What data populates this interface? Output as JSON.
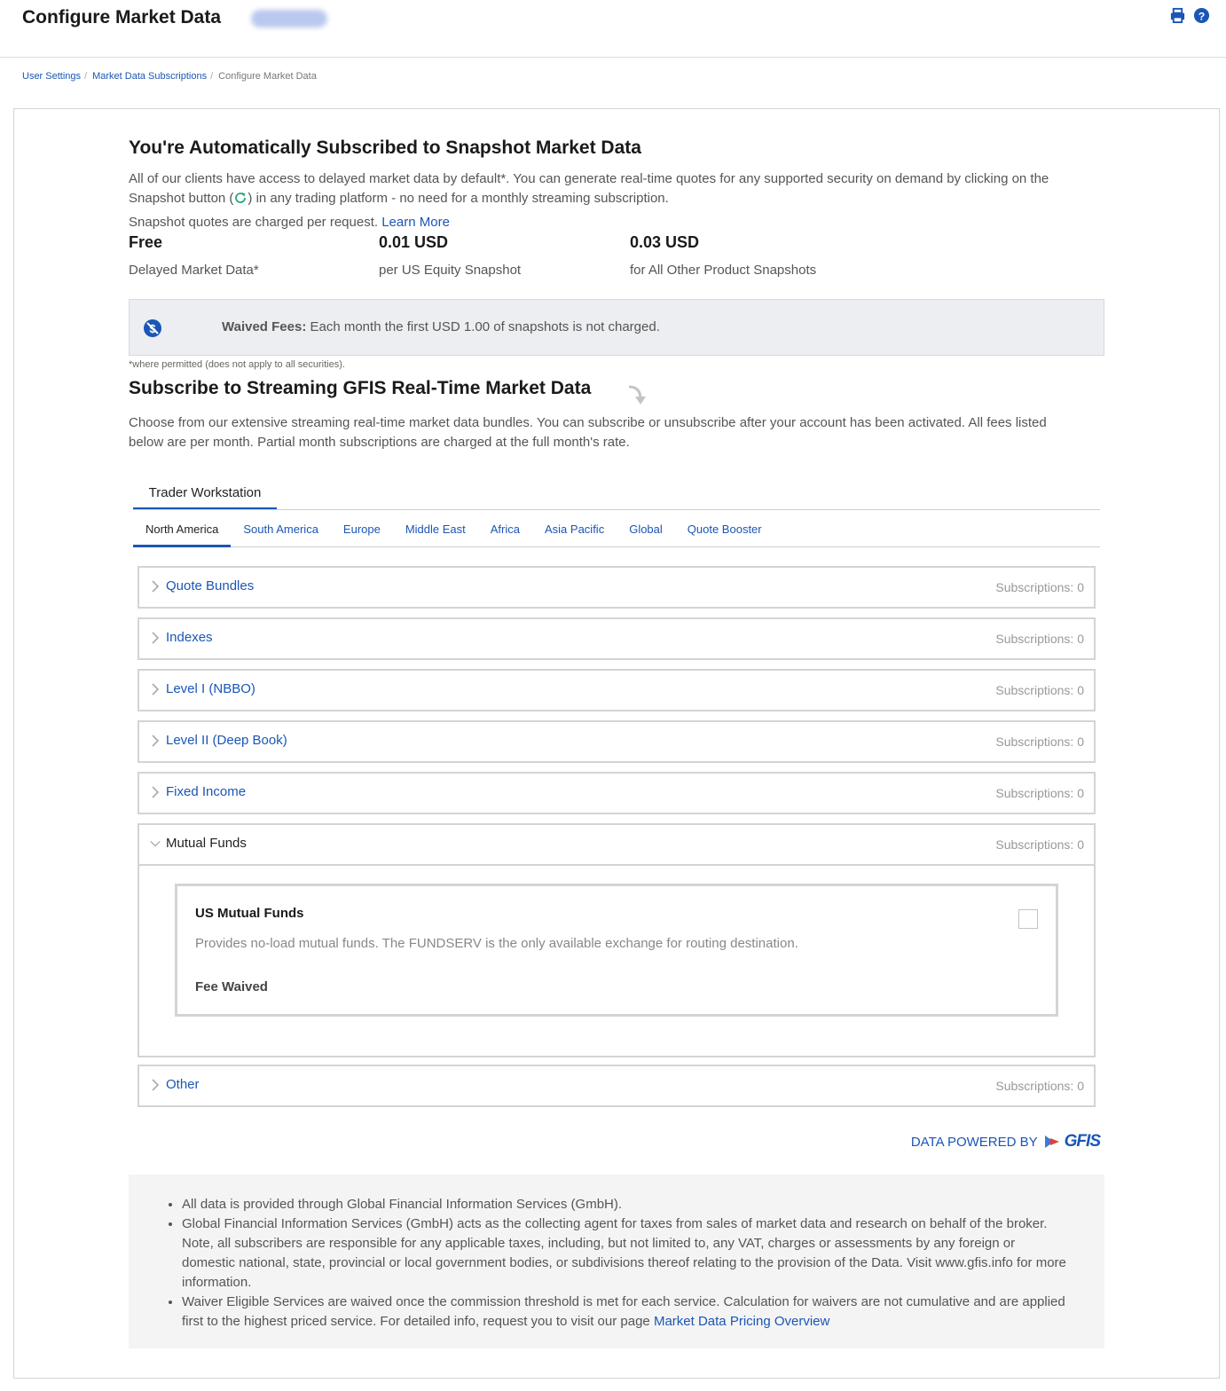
{
  "header": {
    "title": "Configure Market Data",
    "icons": [
      "print-icon",
      "help-icon"
    ]
  },
  "breadcrumb": [
    "User Settings",
    "Market Data Subscriptions",
    "Configure Market Data"
  ],
  "snapshot": {
    "heading": "You're Automatically Subscribed to Snapshot Market Data",
    "para1_a": "All of our clients have access to delayed market data by default*. You can generate real-time quotes for any supported security on demand by clicking on the",
    "para1_b": "Snapshot button (",
    "para1_c": ") in any trading platform - no need for a monthly streaming subscription.",
    "para2": "Snapshot quotes are charged per request.",
    "learn_more": "Learn More",
    "prices": [
      {
        "value": "Free",
        "label": "Delayed Market Data*"
      },
      {
        "value": "0.01 USD",
        "label": "per US Equity Snapshot"
      },
      {
        "value": "0.03 USD",
        "label": "for All Other Product Snapshots"
      }
    ],
    "waived_label": "Waived Fees:",
    "waived_text": "Each month the first USD 1.00 of snapshots is not charged.",
    "footnote": "*where permitted (does not apply to all securities)."
  },
  "streaming": {
    "heading": "Subscribe to Streaming GFIS Real-Time Market Data",
    "para_a": "Choose from our extensive streaming real-time market data bundles. You can subscribe or unsubscribe after your account has been activated. All fees listed",
    "para_b": "below are per month. Partial month subscriptions are charged at the full month's rate."
  },
  "platform_tab": "Trader Workstation",
  "region_tabs": [
    "North America",
    "South America",
    "Europe",
    "Middle East",
    "Africa",
    "Asia Pacific",
    "Global",
    "Quote Booster"
  ],
  "active_region": "North America",
  "categories": [
    {
      "title": "Quote Bundles",
      "count": "Subscriptions: 0"
    },
    {
      "title": "Indexes",
      "count": "Subscriptions: 0"
    },
    {
      "title": "Level I (NBBO)",
      "count": "Subscriptions: 0"
    },
    {
      "title": "Level II (Deep Book)",
      "count": "Subscriptions: 0"
    },
    {
      "title": "Fixed Income",
      "count": "Subscriptions: 0"
    },
    {
      "title": "Mutual Funds",
      "count": "Subscriptions: 0"
    },
    {
      "title": "Other",
      "count": "Subscriptions: 0"
    }
  ],
  "mutual_funds_card": {
    "title": "US Mutual Funds",
    "description": "Provides no-load mutual funds. The FUNDSERV is the only available exchange for routing destination.",
    "fee": "Fee Waived",
    "checked": false
  },
  "powered_by": {
    "label": "DATA POWERED BY",
    "logo_text": "GFIS"
  },
  "notes": {
    "n1": "All data is provided through Global Financial Information Services (GmbH).",
    "n2": "Global Financial Information Services (GmbH) acts as the collecting agent for taxes from sales of market data and research on behalf of the broker. Note, all subscribers are responsible for any applicable taxes, including, but not limited to, any VAT, charges or assessments by any foreign or domestic national, state, provincial or local government bodies, or subdivisions thereof relating to the provision of the Data. Visit www.gfis.info for more information.",
    "n3": "Waiver Eligible Services are waived once the commission threshold is met for each service. Calculation for waivers are not cumulative and are applied first to the highest priced service. For detailed info, request you to visit our page",
    "n3_link": "Market Data Pricing Overview"
  },
  "colors": {
    "accent": "#1a56b5",
    "border": "#d4d4d4",
    "snapshot_green": "#2aa876"
  }
}
